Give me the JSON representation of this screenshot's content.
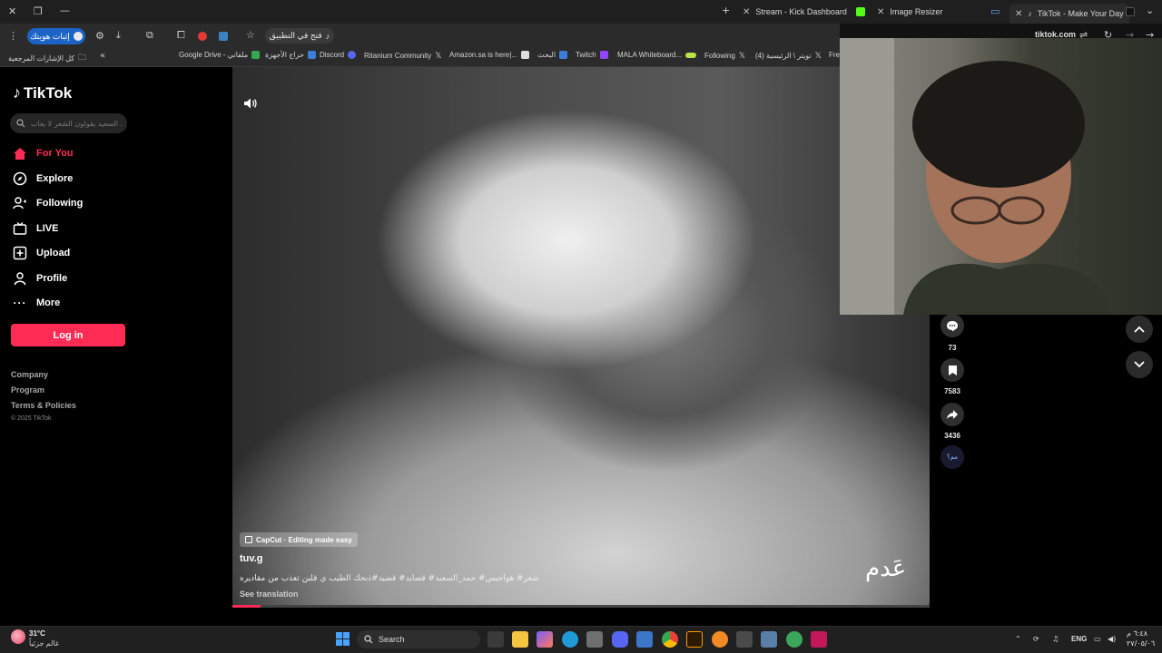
{
  "browser": {
    "tabs": [
      {
        "label": "Stream - Kick Dashboard",
        "color": "#53fc18"
      },
      {
        "label": "Image Resizer",
        "color": "#2fb36b"
      },
      {
        "label": "TikTok - Make Your Day",
        "color": "#ffffff",
        "active": true
      }
    ],
    "verify_label": "إثبات هويتك",
    "open_app_label": "فتح في التطبيق",
    "url": "tiktok.com",
    "bookmarks": [
      {
        "label": "كل الإشارات المرجعية"
      },
      {
        "label": "Google Drive - ملفاتي"
      },
      {
        "label": "حراج الأجهزة"
      },
      {
        "label": "Discord"
      },
      {
        "label": "Ritanium Community"
      },
      {
        "label": "Amazon.sa is here|..."
      },
      {
        "label": "البحث"
      },
      {
        "label": "Twitch"
      },
      {
        "label": "MALA Whiteboard..."
      },
      {
        "label": "Following"
      },
      {
        "label": "تويتر \\ الرئيسية (4)"
      },
      {
        "label": "Free"
      }
    ]
  },
  "tiktok": {
    "logo": "TikTok",
    "search_placeholder": "حمد السعيد يقولون الشعر لا يعاب",
    "nav": [
      {
        "label": "For You",
        "active": true
      },
      {
        "label": "Explore"
      },
      {
        "label": "Following"
      },
      {
        "label": "LIVE"
      },
      {
        "label": "Upload"
      },
      {
        "label": "Profile"
      },
      {
        "label": "More"
      }
    ],
    "login_label": "Log in",
    "footer": [
      "Company",
      "Program",
      "Terms & Policies"
    ],
    "copyright": "© 2025 TikTok",
    "accent": "#fe2c55"
  },
  "video": {
    "capcut_label": "CapCut · Editing made easy",
    "author": "tuv.g",
    "description": "شعر# هواجيس# حمد_السعيد# قصايد# قصيد#ذبحك الطيب ي قلبن تعذب من مقاديره",
    "see_translation": "See translation",
    "watermark": "عَدم",
    "progress": 0.04
  },
  "actions": {
    "comments": "73",
    "saves": "7583",
    "shares": "3436",
    "extra": "مم؟"
  },
  "taskbar": {
    "weather_temp": "31°C",
    "weather_desc": "غالم جزئياً",
    "search_label": "Search",
    "lang": "ENG",
    "time": "٦:٤٨ م",
    "date": "٢٧/٠٥/٠٦"
  }
}
